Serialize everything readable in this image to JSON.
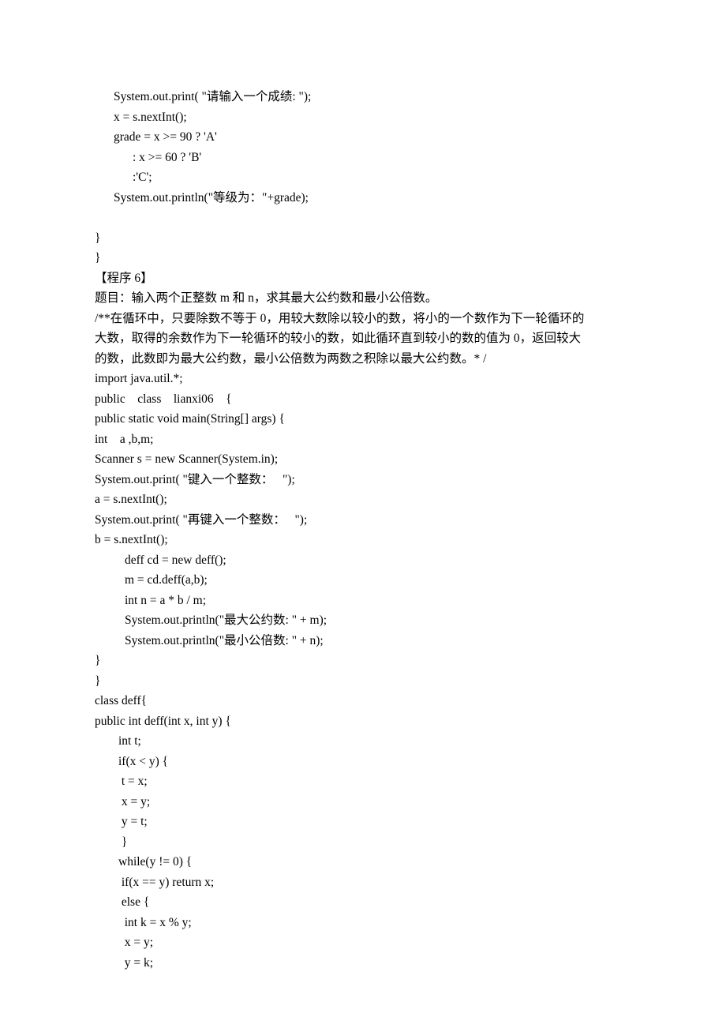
{
  "lines": [
    {
      "cls": "indent1",
      "text": "System.out.print( \"请输入一个成绩: \");"
    },
    {
      "cls": "indent1",
      "text": "x = s.nextInt();"
    },
    {
      "cls": "indent1",
      "text": "grade = x >= 90 ? 'A'"
    },
    {
      "cls": "indent2",
      "text": ": x >= 60 ? 'B'"
    },
    {
      "cls": "indent2",
      "text": ":'C';"
    },
    {
      "cls": "indent1",
      "text": "System.out.println(\"等级为：\"+grade);"
    },
    {
      "cls": "",
      "text": " "
    },
    {
      "cls": "",
      "text": "}"
    },
    {
      "cls": "",
      "text": "}"
    },
    {
      "cls": "",
      "text": "【程序 6】"
    },
    {
      "cls": "",
      "text": "题目：输入两个正整数 m 和 n，求其最大公约数和最小公倍数。"
    },
    {
      "cls": "",
      "text": "/**在循环中，只要除数不等于 0，用较大数除以较小的数，将小的一个数作为下一轮循环的"
    },
    {
      "cls": "",
      "text": "大数，取得的余数作为下一轮循环的较小的数，如此循环直到较小的数的值为 0，返回较大"
    },
    {
      "cls": "",
      "text": "的数，此数即为最大公约数，最小公倍数为两数之积除以最大公约数。* /"
    },
    {
      "cls": "",
      "text": "import java.util.*;"
    },
    {
      "cls": "",
      "text": "public    class    lianxi06    {"
    },
    {
      "cls": "",
      "text": "public static void main(String[] args) {"
    },
    {
      "cls": "",
      "text": "int    a ,b,m;"
    },
    {
      "cls": "",
      "text": "Scanner s = new Scanner(System.in);"
    },
    {
      "cls": "",
      "text": "System.out.print( \"键入一个整数：   \");"
    },
    {
      "cls": "",
      "text": "a = s.nextInt();"
    },
    {
      "cls": "",
      "text": "System.out.print( \"再键入一个整数：   \");"
    },
    {
      "cls": "",
      "text": "b = s.nextInt();"
    },
    {
      "cls": "indent3",
      "text": "deff cd = new deff();"
    },
    {
      "cls": "indent3",
      "text": "m = cd.deff(a,b);"
    },
    {
      "cls": "indent3",
      "text": "int n = a * b / m;"
    },
    {
      "cls": "indent3",
      "text": "System.out.println(\"最大公约数: \" + m);"
    },
    {
      "cls": "indent3",
      "text": "System.out.println(\"最小公倍数: \" + n);"
    },
    {
      "cls": "",
      "text": "}"
    },
    {
      "cls": "",
      "text": "}"
    },
    {
      "cls": "",
      "text": "class deff{"
    },
    {
      "cls": "",
      "text": "public int deff(int x, int y) {"
    },
    {
      "cls": "indent4",
      "text": "int t;"
    },
    {
      "cls": "indent4",
      "text": "if(x < y) {"
    },
    {
      "cls": "indent4",
      "text": " t = x;"
    },
    {
      "cls": "indent4",
      "text": " x = y;"
    },
    {
      "cls": "indent4",
      "text": " y = t;"
    },
    {
      "cls": "indent4",
      "text": " }"
    },
    {
      "cls": "indent4",
      "text": "while(y != 0) {"
    },
    {
      "cls": "indent4",
      "text": " if(x == y) return x;"
    },
    {
      "cls": "indent4",
      "text": " else {"
    },
    {
      "cls": "indent4",
      "text": "  int k = x % y;"
    },
    {
      "cls": "indent4",
      "text": "  x = y;"
    },
    {
      "cls": "indent4",
      "text": "  y = k;"
    }
  ]
}
